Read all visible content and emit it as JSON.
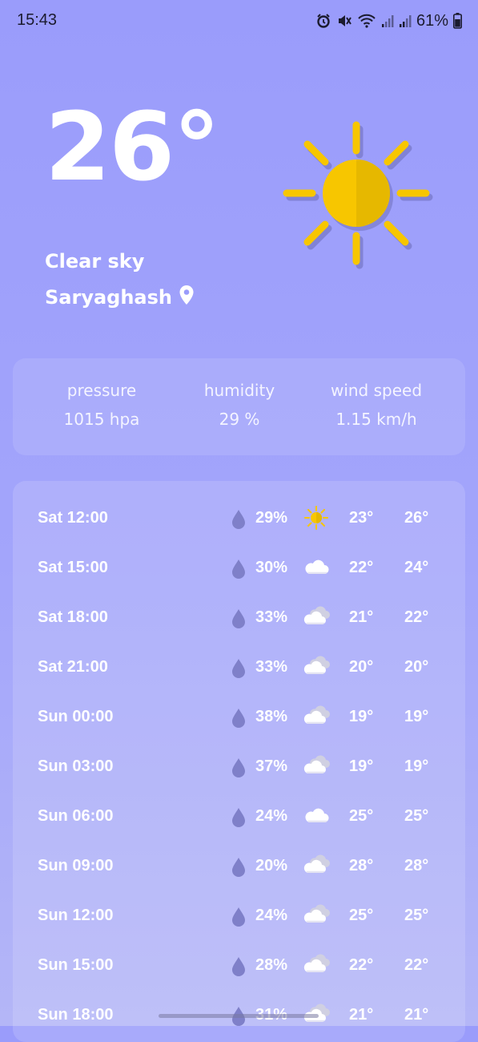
{
  "status": {
    "time": "15:43",
    "battery": "61%",
    "icons": [
      "alarm-icon",
      "mute-icon",
      "wifi-icon",
      "signal-icon",
      "signal-icon",
      "battery-icon"
    ]
  },
  "current": {
    "temperature": "26°",
    "condition": "Clear sky",
    "location": "Saryaghash",
    "icon": "sun-icon",
    "location_icon": "location-pin-icon"
  },
  "stats": {
    "pressure_label": "pressure",
    "pressure_value": "1015 hpa",
    "humidity_label": "humidity",
    "humidity_value": "29 %",
    "wind_label": "wind speed",
    "wind_value": "1.15 km/h"
  },
  "forecast": [
    {
      "time": "Sat 12:00",
      "humidity": "29%",
      "icon": "sun-icon",
      "min": "23°",
      "max": "26°"
    },
    {
      "time": "Sat 15:00",
      "humidity": "30%",
      "icon": "cloud-icon",
      "min": "22°",
      "max": "24°"
    },
    {
      "time": "Sat 18:00",
      "humidity": "33%",
      "icon": "clouds-icon",
      "min": "21°",
      "max": "22°"
    },
    {
      "time": "Sat 21:00",
      "humidity": "33%",
      "icon": "clouds-icon",
      "min": "20°",
      "max": "20°"
    },
    {
      "time": "Sun 00:00",
      "humidity": "38%",
      "icon": "clouds-icon",
      "min": "19°",
      "max": "19°"
    },
    {
      "time": "Sun 03:00",
      "humidity": "37%",
      "icon": "clouds-icon",
      "min": "19°",
      "max": "19°"
    },
    {
      "time": "Sun 06:00",
      "humidity": "24%",
      "icon": "cloud-icon",
      "min": "25°",
      "max": "25°"
    },
    {
      "time": "Sun 09:00",
      "humidity": "20%",
      "icon": "clouds-icon",
      "min": "28°",
      "max": "28°"
    },
    {
      "time": "Sun 12:00",
      "humidity": "24%",
      "icon": "clouds-icon",
      "min": "25°",
      "max": "25°"
    },
    {
      "time": "Sun 15:00",
      "humidity": "28%",
      "icon": "clouds-icon",
      "min": "22°",
      "max": "22°"
    },
    {
      "time": "Sun 18:00",
      "humidity": "31%",
      "icon": "clouds-icon",
      "min": "21°",
      "max": "21°"
    }
  ],
  "colors": {
    "background": "#9a9cfb",
    "sun": "#f7c600",
    "sun_shade": "#e6b800",
    "drop": "#7f80c9",
    "text": "#ffffff"
  }
}
